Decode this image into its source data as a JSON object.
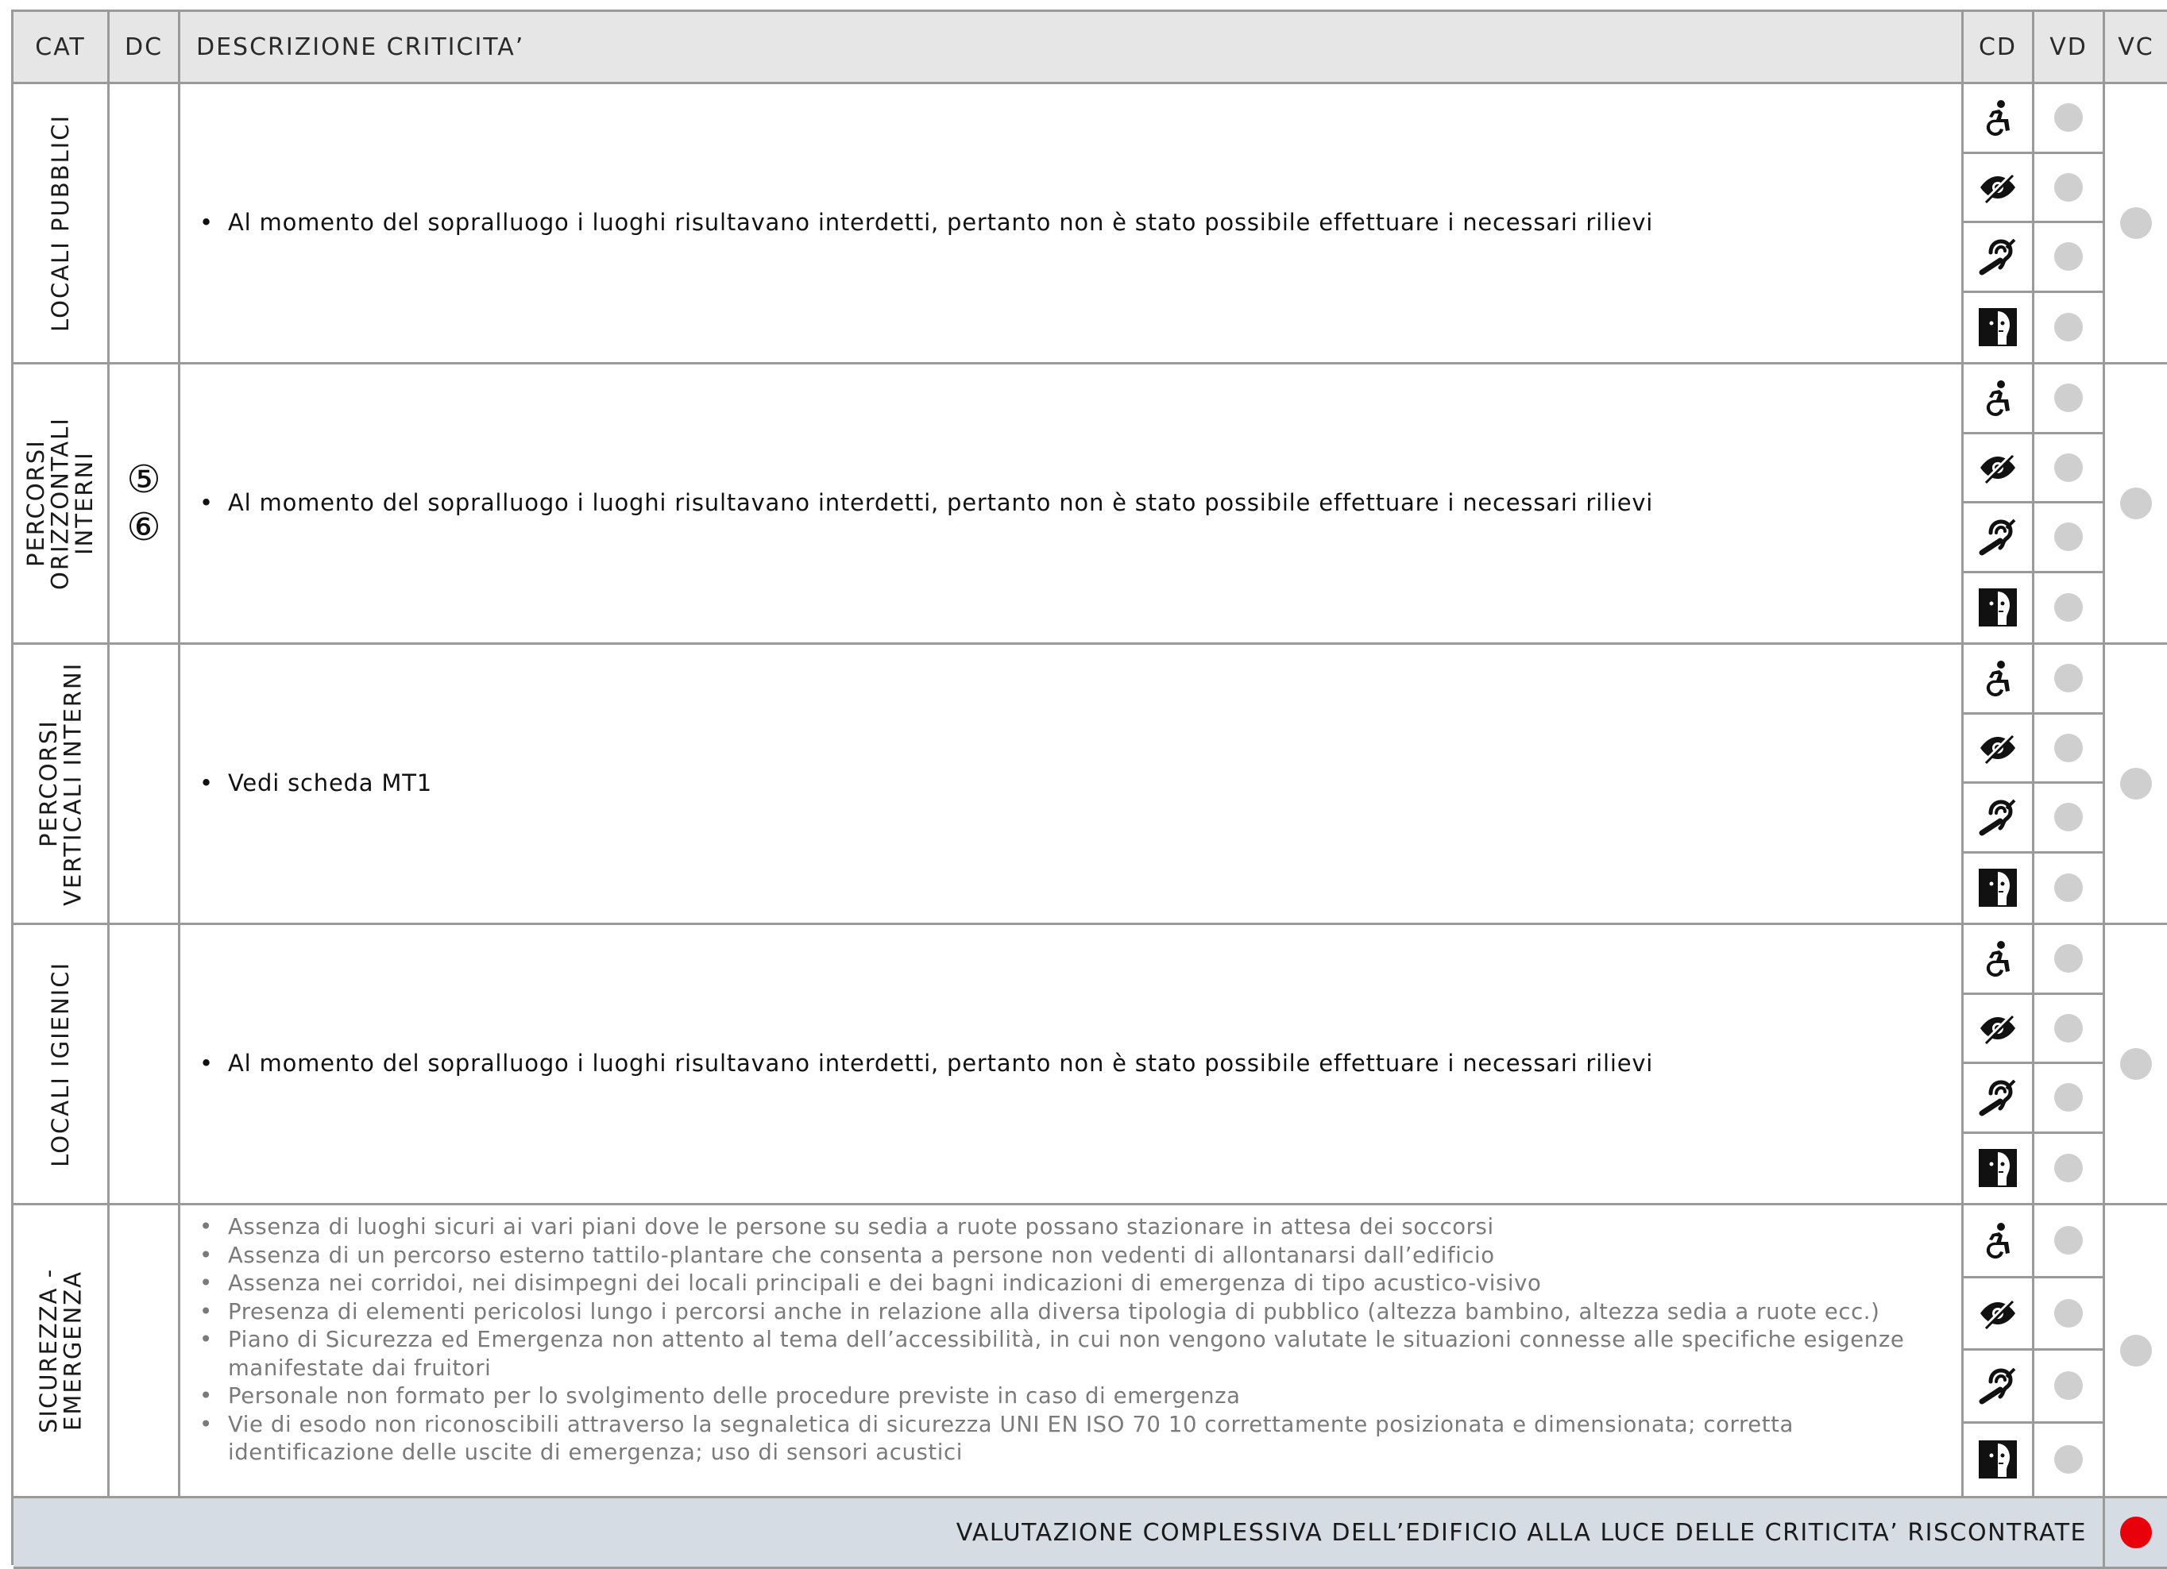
{
  "header": {
    "cat": "CAT",
    "dc": "DC",
    "descrizione": "DESCRIZIONE CRITICITA’",
    "cd": "CD",
    "vd": "VD",
    "vc": "VC"
  },
  "rows": [
    {
      "category": "LOCALI PUBBLICI",
      "dc": [],
      "items": [
        "Al momento del sopralluogo i luoghi risultavano interdetti, pertanto non è stato possibile effettuare i necessari rilievi"
      ],
      "vd_colors": [
        "#cfcfcf",
        "#cfcfcf",
        "#cfcfcf",
        "#cfcfcf"
      ],
      "vc_color": "#cfcfcf"
    },
    {
      "category": "PERCORSI ORIZZONTALI INTERNI",
      "dc": [
        "⑤",
        "⑥"
      ],
      "items": [
        "Al momento del sopralluogo i luoghi risultavano interdetti, pertanto non è stato possibile effettuare i necessari rilievi"
      ],
      "vd_colors": [
        "#cfcfcf",
        "#cfcfcf",
        "#cfcfcf",
        "#cfcfcf"
      ],
      "vc_color": "#cfcfcf"
    },
    {
      "category": "PERCORSI VERTICALI INTERNI",
      "dc": [],
      "items": [
        "Vedi scheda MT1"
      ],
      "vd_colors": [
        "#cfcfcf",
        "#cfcfcf",
        "#cfcfcf",
        "#cfcfcf"
      ],
      "vc_color": "#cfcfcf"
    },
    {
      "category": "LOCALI IGIENICI",
      "dc": [],
      "items": [
        "Al momento del sopralluogo i luoghi risultavano interdetti, pertanto non è stato possibile effettuare i necessari rilievi"
      ],
      "vd_colors": [
        "#cfcfcf",
        "#cfcfcf",
        "#cfcfcf",
        "#cfcfcf"
      ],
      "vc_color": "#cfcfcf"
    },
    {
      "category": "SICUREZZA - EMERGENZA",
      "dc": [],
      "items": [
        "Assenza di luoghi sicuri ai vari piani dove le persone su sedia a ruote possano stazionare  in attesa dei soccorsi",
        "Assenza di un percorso esterno tattilo-plantare che consenta a persone non vedenti di allontanarsi dall’edificio",
        "Assenza nei corridoi, nei disimpegni dei locali principali e dei bagni indicazioni di emergenza di tipo acustico-visivo",
        "Presenza di elementi pericolosi lungo i percorsi anche in relazione alla diversa tipologia di pubblico (altezza bambino, altezza sedia a ruote ecc.)",
        "Piano di Sicurezza ed Emergenza non attento al tema dell’accessibilità, in cui non vengono valutate le situazioni connesse alle specifiche esigenze manifestate dai fruitori",
        "Personale non formato per lo svolgimento delle procedure previste in caso di emergenza",
        "Vie di esodo non riconoscibili attraverso la segnaletica di sicurezza UNI EN ISO 70 10 correttamente posizionata e dimensionata; corretta identificazione delle uscite di emergenza; uso di sensori acustici"
      ],
      "vd_colors": [
        "#cfcfcf",
        "#cfcfcf",
        "#cfcfcf",
        "#cfcfcf"
      ],
      "vc_color": "#cfcfcf"
    }
  ],
  "cd_icons": [
    "wheelchair-icon",
    "visual-impairment-icon",
    "hearing-impairment-icon",
    "cognitive-impairment-icon"
  ],
  "footer": {
    "label": "VALUTAZIONE COMPLESSIVA DELL’EDIFICIO ALLA LUCE DELLE CRITICITA’ RISCONTRATE",
    "color": "#e8000b"
  }
}
